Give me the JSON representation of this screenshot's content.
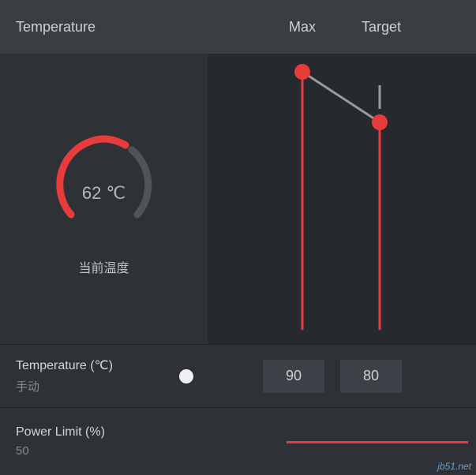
{
  "header": {
    "title": "Temperature",
    "max_label": "Max",
    "target_label": "Target"
  },
  "gauge": {
    "value_text": "62 ℃",
    "label": "当前温度",
    "value": 62,
    "min": 0,
    "max": 100
  },
  "sliders": {
    "max": {
      "value": 90,
      "y_ratio": 0.05
    },
    "target": {
      "value": 80,
      "y_ratio": 0.22
    }
  },
  "temperature_setting": {
    "title": "Temperature (℃)",
    "mode": "手动",
    "max_value": "90",
    "target_value": "80"
  },
  "power_limit": {
    "title": "Power Limit (%)",
    "value": "50"
  },
  "watermark": "jb51.net",
  "colors": {
    "accent": "#e83c3c",
    "bg_dark": "#26292d",
    "bg_panel": "#2e3136",
    "bg_header": "#3a3d42"
  },
  "chart_data": {
    "type": "line",
    "title": "Temperature Max/Target Sliders",
    "series": [
      {
        "name": "Max",
        "x": 0,
        "value": 90
      },
      {
        "name": "Target",
        "x": 1,
        "value": 80
      }
    ],
    "ylim": [
      0,
      100
    ],
    "xlabel": "",
    "ylabel": "Temperature (℃)"
  }
}
